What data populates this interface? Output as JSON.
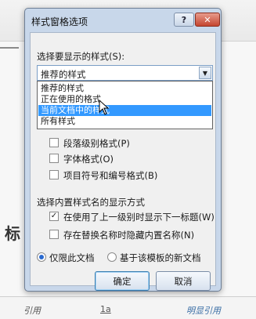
{
  "dialog": {
    "title": "样式窗格选项",
    "help_label": "?",
    "close_label": "✕",
    "select_label": "选择要显示的样式(S):",
    "select_value": "推荐的样式",
    "options": [
      "推荐的样式",
      "正在使用的格式",
      "当前文档中的样式",
      "所有样式"
    ],
    "selected_option_index": 2,
    "format_checkboxes": [
      {
        "label": "段落级别格式(P)",
        "checked": false
      },
      {
        "label": "字体格式(O)",
        "checked": false
      },
      {
        "label": "项目符号和编号格式(B)",
        "checked": false
      }
    ],
    "builtin_group_label": "选择内置样式名的显示方式",
    "builtin_checkboxes": [
      {
        "label": "在使用了上一级别时显示下一标题(W)",
        "checked": true
      },
      {
        "label": "存在替换名称时隐藏内置名称(N)",
        "checked": false
      }
    ],
    "radios": [
      {
        "label": "仅限此文档",
        "selected": true
      },
      {
        "label": "基于该模板的新文档",
        "selected": false
      }
    ],
    "ok_label": "确定",
    "cancel_label": "取消"
  },
  "background": {
    "heading_fragment": "标",
    "bottom_styles": [
      "引用",
      "1a",
      "明显引用"
    ]
  }
}
